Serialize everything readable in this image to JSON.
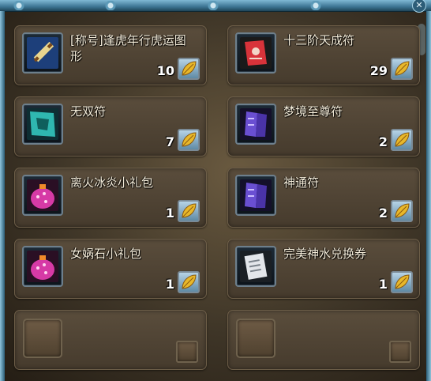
{
  "colors": {
    "frame_accent": "#3d7593",
    "slot_bg": "#5a4d3c",
    "name_text": "#f6eedb",
    "qty_text": "#ffffff",
    "currency_gold": "#e8b82a"
  },
  "window": {
    "close_label": "✕"
  },
  "items": [
    {
      "name": "[称号]逢虎年行虎运图形",
      "qty": "10",
      "icon": "scroll-icon",
      "currency_icon": "gold-leaf-icon"
    },
    {
      "name": "十三阶天成符",
      "qty": "29",
      "icon": "red-talisman-icon",
      "currency_icon": "gold-leaf-icon"
    },
    {
      "name": "无双符",
      "qty": "7",
      "icon": "teal-talisman-icon",
      "currency_icon": "gold-leaf-icon"
    },
    {
      "name": "梦境至尊符",
      "qty": "2",
      "icon": "purple-talisman-icon",
      "currency_icon": "gold-leaf-icon"
    },
    {
      "name": "离火冰炎小礼包",
      "qty": "1",
      "icon": "gift-bag-icon",
      "currency_icon": "gold-leaf-icon"
    },
    {
      "name": "神通符",
      "qty": "2",
      "icon": "purple-talisman-icon",
      "currency_icon": "gold-leaf-icon"
    },
    {
      "name": "女娲石小礼包",
      "qty": "1",
      "icon": "gift-bag-icon",
      "currency_icon": "gold-leaf-icon"
    },
    {
      "name": "完美神水兑换券",
      "qty": "1",
      "icon": "voucher-icon",
      "currency_icon": "gold-leaf-icon"
    }
  ]
}
